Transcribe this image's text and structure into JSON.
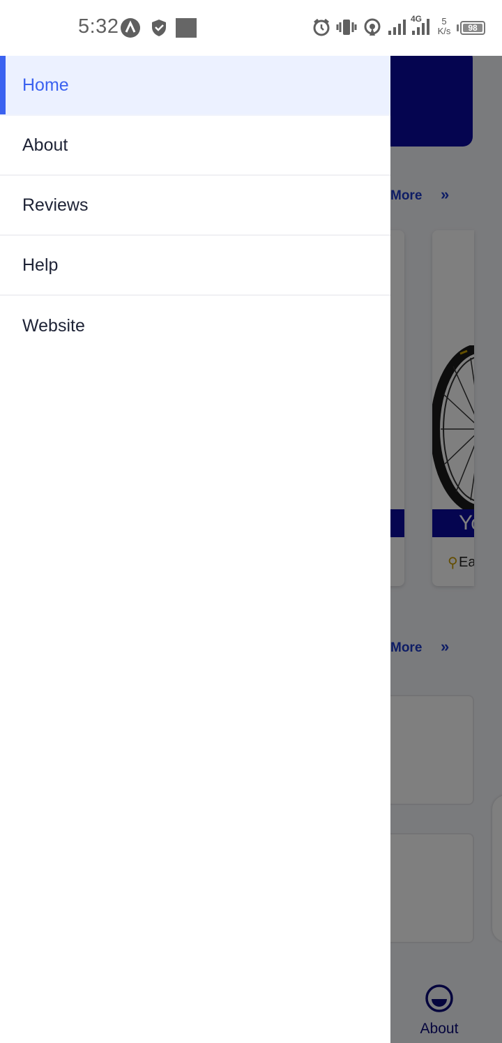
{
  "status_bar": {
    "time": "5:32",
    "network_type": "4G",
    "speed_value": "5",
    "speed_unit": "K/s",
    "battery": "98"
  },
  "drawer": {
    "items": [
      {
        "label": "Home",
        "active": true
      },
      {
        "label": "About",
        "active": false
      },
      {
        "label": "Reviews",
        "active": false
      },
      {
        "label": "Help",
        "active": false
      },
      {
        "label": "Website",
        "active": false
      }
    ]
  },
  "background": {
    "section1_more": "More",
    "section2_more": "More",
    "card2_title": "Yo",
    "card2_location": "Ea",
    "bottom_nav_about": "About"
  },
  "colors": {
    "accent": "#3b62f0",
    "active_bg": "#ecf1ff",
    "brand_navy": "#0a0aa0"
  }
}
